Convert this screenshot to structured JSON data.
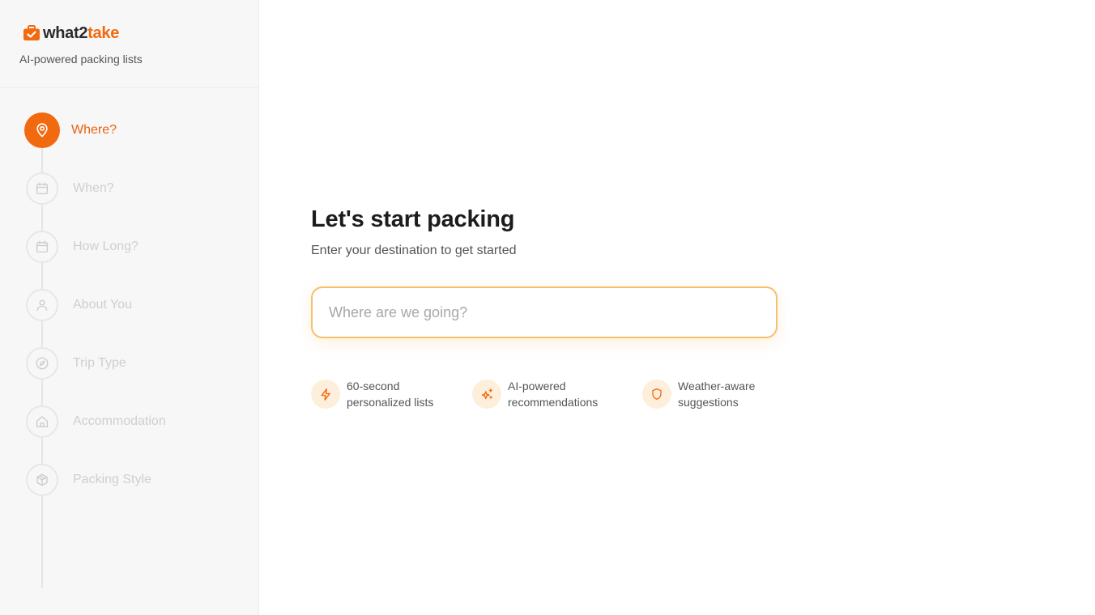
{
  "brand": {
    "name_part1": "what2",
    "name_part2": "take",
    "tagline": "AI-powered packing lists",
    "accent_color": "#f26a0f"
  },
  "sidebar": {
    "steps": [
      {
        "label": "Where?",
        "icon": "map-pin-icon",
        "active": true
      },
      {
        "label": "When?",
        "icon": "calendar-icon",
        "active": false
      },
      {
        "label": "How Long?",
        "icon": "calendar-icon",
        "active": false
      },
      {
        "label": "About You",
        "icon": "user-icon",
        "active": false
      },
      {
        "label": "Trip Type",
        "icon": "compass-icon",
        "active": false
      },
      {
        "label": "Accommodation",
        "icon": "home-icon",
        "active": false
      },
      {
        "label": "Packing Style",
        "icon": "package-icon",
        "active": false
      }
    ]
  },
  "main": {
    "title": "Let's start packing",
    "subtitle": "Enter your destination to get started",
    "input": {
      "placeholder": "Where are we going?",
      "value": ""
    },
    "features": [
      {
        "icon": "lightning-icon",
        "line1": "60-second",
        "line2": "personalized lists"
      },
      {
        "icon": "sparkles-icon",
        "line1": "AI-powered",
        "line2": "recommendations"
      },
      {
        "icon": "shield-icon",
        "line1": "Weather-aware",
        "line2": "suggestions"
      }
    ]
  }
}
